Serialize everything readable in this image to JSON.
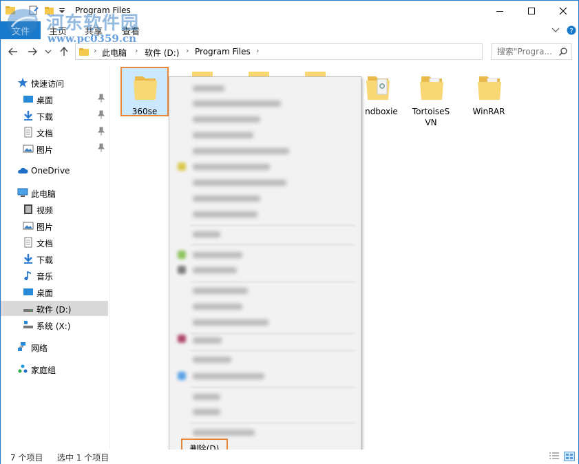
{
  "window": {
    "title": "Program Files"
  },
  "ribbon": {
    "tabs": [
      "文件",
      "主页",
      "共享",
      "查看"
    ]
  },
  "watermark": {
    "name": "河东软件园",
    "url": "www.pc0359.cn"
  },
  "address": {
    "crumbs": [
      "此电脑",
      "软件 (D:)",
      "Program Files"
    ]
  },
  "search": {
    "placeholder": "搜索\"Progra..."
  },
  "nav": {
    "quick_access": "快速访问",
    "quick_items": [
      "桌面",
      "下载",
      "文档",
      "图片"
    ],
    "onedrive": "OneDrive",
    "this_pc": "此电脑",
    "pc_items": [
      "视频",
      "图片",
      "文档",
      "下载",
      "音乐",
      "桌面",
      "软件 (D:)",
      "系统 (X:)"
    ],
    "network": "网络",
    "homegroup": "家庭组"
  },
  "folders": [
    {
      "name": "360se",
      "selected": true
    },
    {
      "name": "ndboxie"
    },
    {
      "name": "TortoiseS\nVN"
    },
    {
      "name": "WinRAR"
    }
  ],
  "context_menu": {
    "delete_label": "删除(D)"
  },
  "status": {
    "item_count": "7 个项目",
    "selection": "选中 1 个项目"
  },
  "colors": {
    "accent": "#1979ca",
    "highlight_border": "#e8863a",
    "selection": "#cce8ff",
    "folder": "#f8d775"
  }
}
